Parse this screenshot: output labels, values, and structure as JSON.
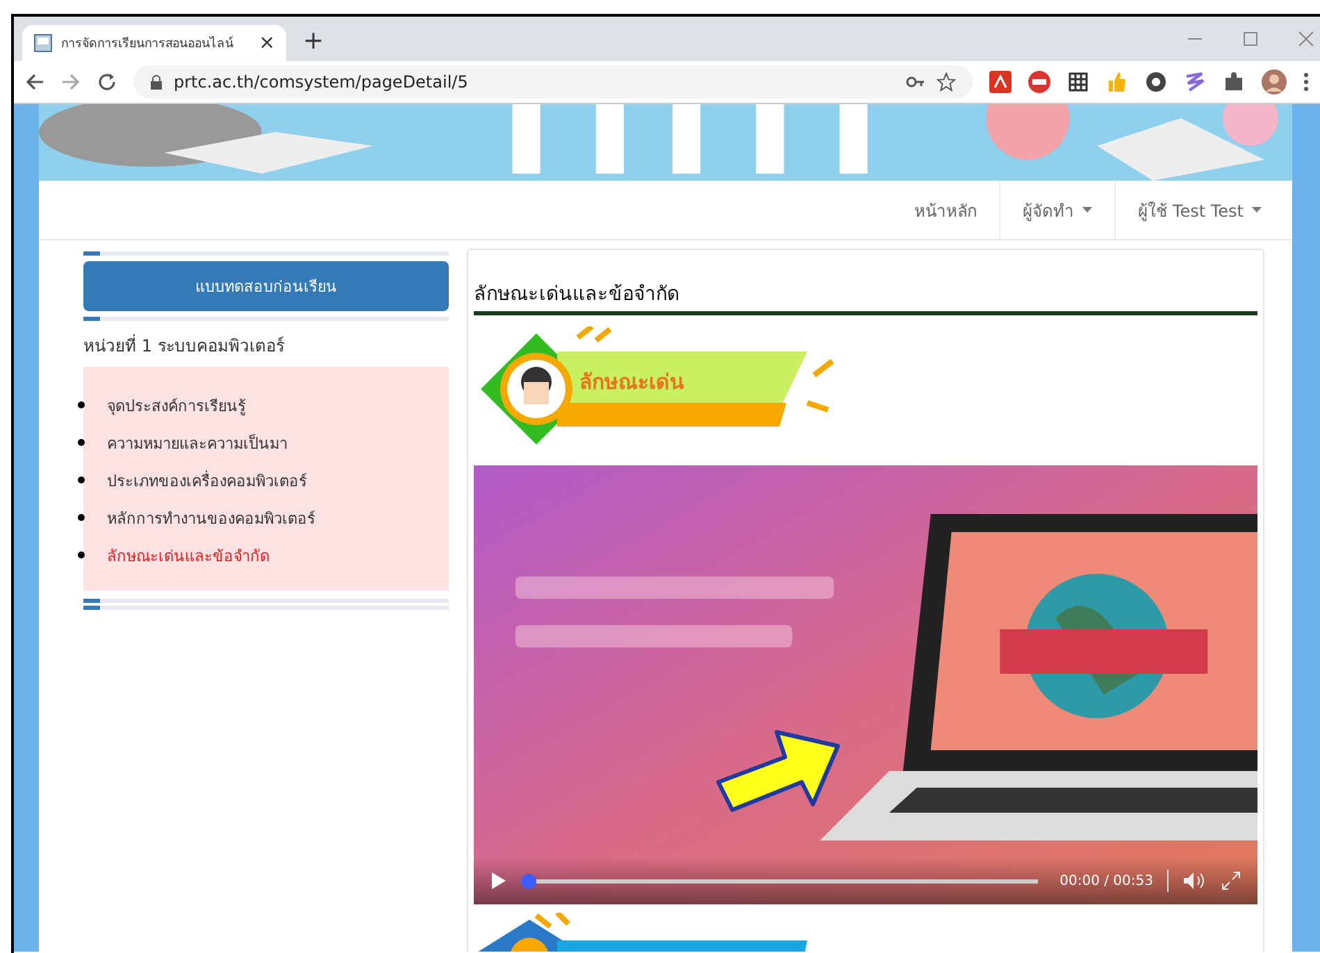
{
  "browser": {
    "tab_title": "การจัดการเรียนการสอนออนไลน์",
    "tab_close": "×",
    "new_tab": "+",
    "url": "prtc.ac.th/comsystem/pageDetail/5"
  },
  "nav": [
    {
      "label": "หน้าหลัก",
      "dropdown": false
    },
    {
      "label": "ผู้จัดทำ",
      "dropdown": true
    },
    {
      "label": "ผู้ใช้ Test Test",
      "dropdown": true
    }
  ],
  "sidebar": {
    "button": "แบบทดสอบก่อนเรียน",
    "unit_title": "หน่วยที่ 1 ระบบคอมพิวเตอร์",
    "items": [
      {
        "label": "จุดประสงค์การเรียนรู้",
        "selected": false
      },
      {
        "label": "ความหมายและความเป็นมา",
        "selected": false
      },
      {
        "label": "ประเภทของเครื่องคอมพิวเตอร์",
        "selected": false
      },
      {
        "label": "หลักการทำงานของคอมพิวเตอร์",
        "selected": false
      },
      {
        "label": "ลักษณะเด่นและข้อจำกัด",
        "selected": true
      }
    ]
  },
  "main": {
    "title": "ลักษณะเด่นและข้อจำกัด",
    "banner_label": "ลักษณะเด่น",
    "video": {
      "time": "00:00 / 00:53",
      "level": 0.0
    }
  }
}
